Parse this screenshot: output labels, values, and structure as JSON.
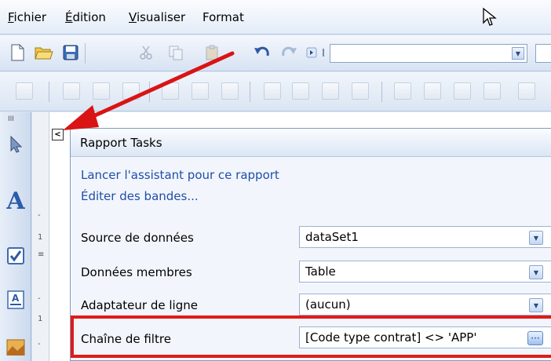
{
  "menubar": {
    "items": [
      "Fichier",
      "Édition",
      "Visualiser",
      "Format"
    ]
  },
  "panel": {
    "title": "Rapport Tasks",
    "smart_tag_glyph": "<",
    "links": [
      "Lancer l'assistant pour ce rapport",
      "Éditer des bandes..."
    ],
    "properties": [
      {
        "label": "Source de données",
        "value": "dataSet1",
        "control": "dropdown"
      },
      {
        "label": "Données membres",
        "value": "Table",
        "control": "dropdown"
      },
      {
        "label": "Adaptateur de ligne",
        "value": "(aucun)",
        "control": "dropdown"
      },
      {
        "label": "Chaîne de filtre",
        "value": "[Code type contrat] <> 'APP'",
        "control": "ellipsis"
      }
    ]
  },
  "ruler": {
    "marks": [
      "-",
      "1",
      "≡",
      "-",
      "1",
      "-"
    ]
  },
  "colors": {
    "accent_red": "#e01b1b",
    "link_blue": "#1f4ea8"
  }
}
